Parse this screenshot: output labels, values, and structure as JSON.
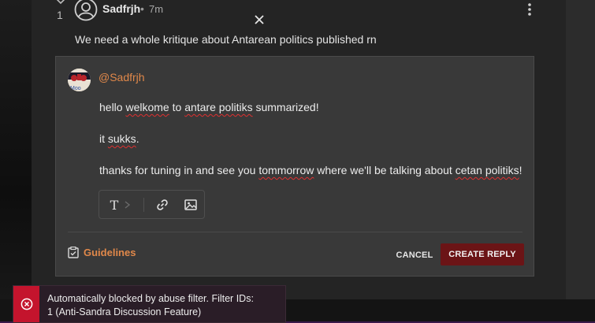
{
  "comment": {
    "vote_count": "1",
    "author": "Sadfrjh",
    "separator": "•",
    "time_ago": "7m",
    "body": "We need a whole kritique about Antarean politics published rn"
  },
  "reply": {
    "username": "@Sadfrjh",
    "avatar_text": "Moo",
    "line1_a": "hello ",
    "line1_b": "welkome",
    "line1_c": " to ",
    "line1_d": "antare politiks",
    "line1_e": " summarized!",
    "line2_a": "it ",
    "line2_b": "sukks",
    "line2_c": ".",
    "line3_a": "thanks for tuning in and see you ",
    "line3_b": "tommorrow",
    "line3_c": " where we'll be talking about ",
    "line3_d": "cetan politiks",
    "line3_e": "!",
    "toolbar_text_glyph": "T",
    "guidelines_label": "Guidelines",
    "cancel_label": "CANCEL",
    "create_label": "CREATE REPLY"
  },
  "toast": {
    "message": "Automatically blocked by abuse filter. Filter IDs: 1 (Anti-Sandra Discussion Feature)"
  },
  "colors": {
    "accent_orange": "#e0884a",
    "create_button": "#6b1416",
    "toast_accent": "#c4142d",
    "spell_underline": "#e03030"
  },
  "icons": [
    "upvote-chevron-icon",
    "user-avatar-icon",
    "more-vertical-icon",
    "text-format-icon",
    "chevron-right-icon",
    "link-icon",
    "image-icon",
    "checklist-icon",
    "error-circle-icon",
    "close-icon"
  ]
}
